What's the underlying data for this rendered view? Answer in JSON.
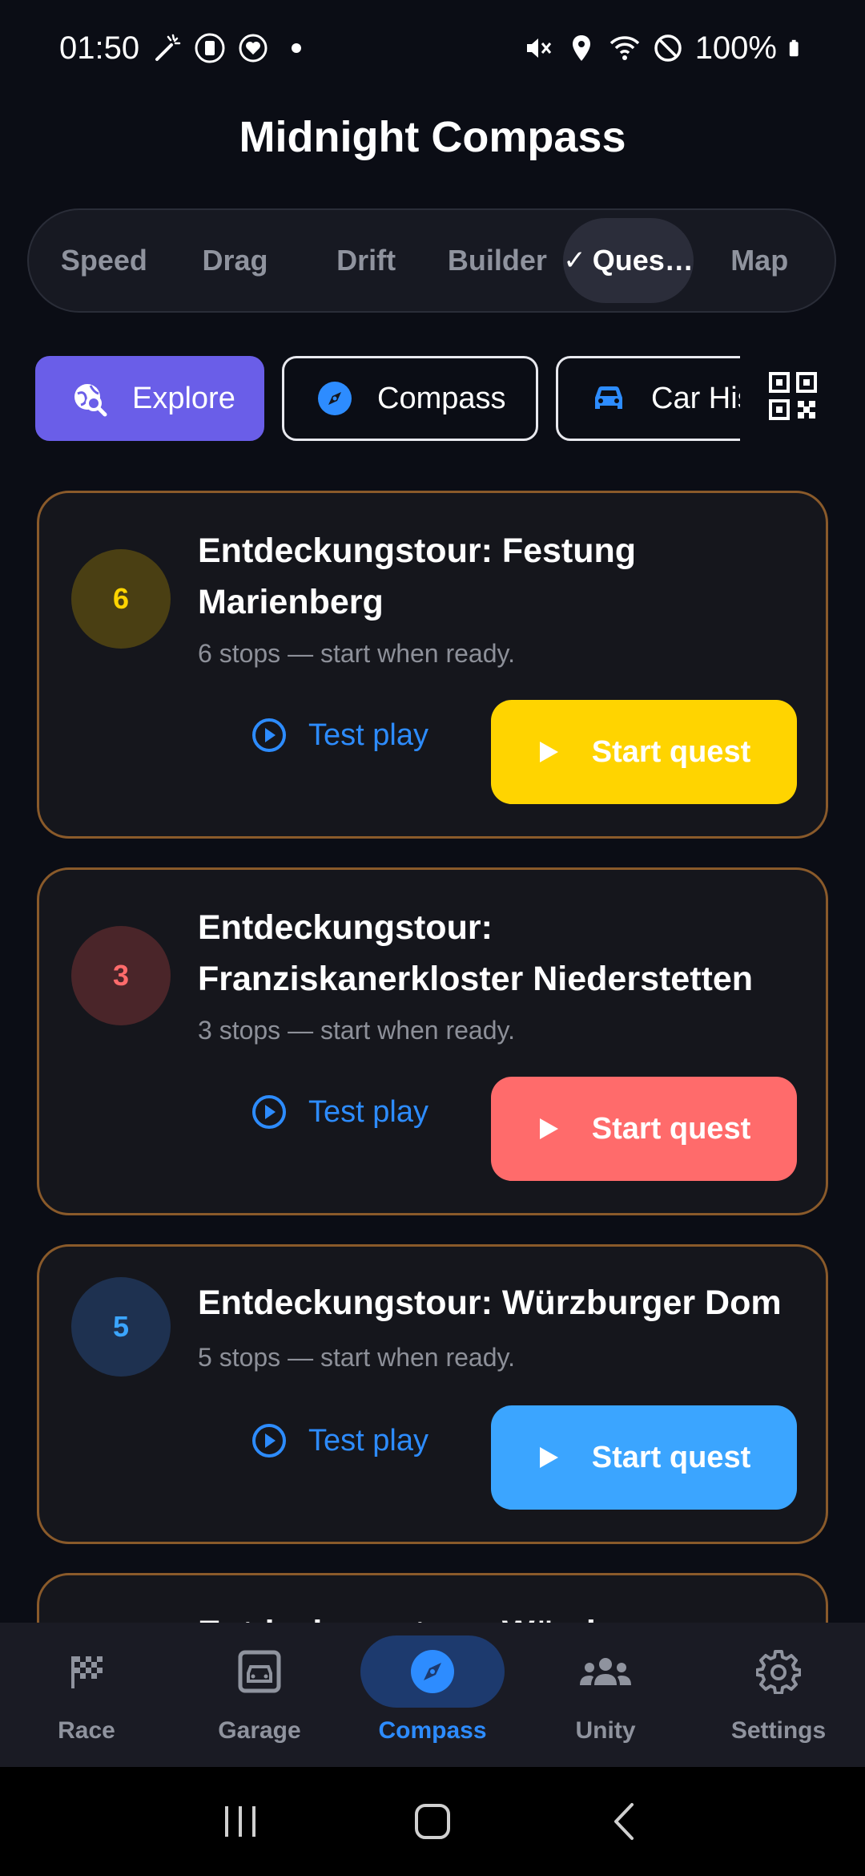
{
  "status": {
    "time": "01:50",
    "battery": "100%",
    "icons": [
      "magic-wand-icon",
      "sim-icon",
      "heart-monitor-icon",
      "dot-icon",
      "mute-icon",
      "location-icon",
      "wifi-icon",
      "dnd-icon",
      "battery-icon"
    ]
  },
  "app": {
    "title": "Midnight Compass"
  },
  "modes": [
    {
      "label": "Speed"
    },
    {
      "label": "Drag"
    },
    {
      "label": "Drift"
    },
    {
      "label": "Builder"
    },
    {
      "label": "Ques…",
      "active": true
    },
    {
      "label": "Map"
    }
  ],
  "chips": [
    {
      "label": "Explore",
      "icon": "globe-search-icon"
    },
    {
      "label": "Compass",
      "icon": "compass-icon"
    },
    {
      "label": "Car His",
      "icon": "car-icon"
    }
  ],
  "qr_icon": "qr-code-icon",
  "quests": [
    {
      "stops": "6",
      "title": "Entdeckungstour: Festung Marienberg",
      "subtitle": "6 stops — start when ready.",
      "test_label": "Test play",
      "start_label": "Start quest",
      "accent": "#ffd400",
      "badge_bg": "#4a3f13",
      "badge_fg": "#ffd400"
    },
    {
      "stops": "3",
      "title": "Entdeckungstour: Franziskanerkloster Niederstetten",
      "subtitle": "3 stops — start when ready.",
      "test_label": "Test play",
      "start_label": "Start quest",
      "accent": "#ff6b6b",
      "badge_bg": "#4a2529",
      "badge_fg": "#ff6b6b"
    },
    {
      "stops": "5",
      "title": "Entdeckungstour: Würzburger Dom",
      "subtitle": "5 stops — start when ready.",
      "test_label": "Test play",
      "start_label": "Start quest",
      "accent": "#3ba5ff",
      "badge_bg": "#1e3150",
      "badge_fg": "#3ba5ff"
    },
    {
      "title": "Entdeckungstour: Würzb",
      "partial": true
    }
  ],
  "nav": [
    {
      "label": "Race",
      "icon": "checkered-flag-icon"
    },
    {
      "label": "Garage",
      "icon": "garage-icon"
    },
    {
      "label": "Compass",
      "icon": "compass-icon",
      "active": true
    },
    {
      "label": "Unity",
      "icon": "group-icon"
    },
    {
      "label": "Settings",
      "icon": "gear-icon"
    }
  ],
  "system_nav": [
    "recents-icon",
    "home-icon",
    "back-icon"
  ]
}
